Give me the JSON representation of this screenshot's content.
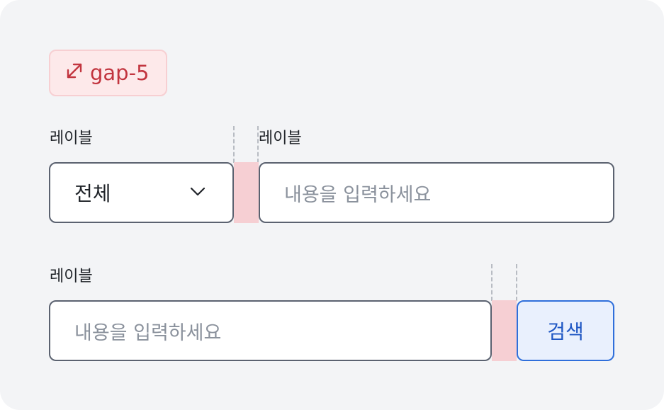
{
  "badge": {
    "icon": "resize-diagonal-icon",
    "label": "gap-5"
  },
  "row1": {
    "select_label": "레이블",
    "select_value": "전체",
    "input_label": "레이블",
    "input_placeholder": "내용을 입력하세요"
  },
  "row2": {
    "input_label": "레이블",
    "input_placeholder": "내용을 입력하세요",
    "button_label": "검색"
  },
  "colors": {
    "gap_highlight": "#f6cfd3",
    "badge_text": "#c2353f",
    "button_accent": "#2f6fdb"
  }
}
